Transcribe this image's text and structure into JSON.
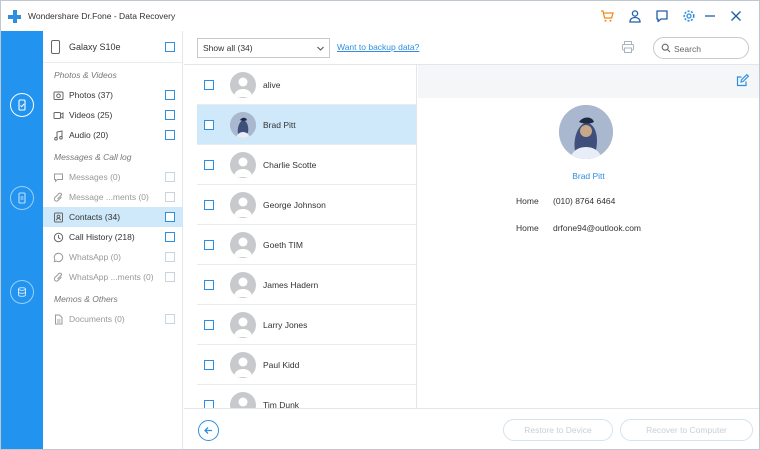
{
  "window": {
    "title": "Wondershare Dr.Fone - Data Recovery",
    "icons": [
      "cart-icon",
      "user-icon",
      "feedback-icon",
      "settings-icon",
      "minimize-icon",
      "close-icon"
    ]
  },
  "colors": {
    "accent": "#2294f0",
    "selected_row": "#cfe9fa",
    "link": "#2e8fe0"
  },
  "device": {
    "name": "Galaxy S10e"
  },
  "categories": {
    "photos_videos": {
      "label": "Photos & Videos",
      "items": [
        {
          "label": "Photos (37)",
          "icon": "photo-icon"
        },
        {
          "label": "Videos (25)",
          "icon": "video-icon"
        },
        {
          "label": "Audio (20)",
          "icon": "audio-icon"
        }
      ]
    },
    "messages_calllog": {
      "label": "Messages & Call log",
      "items": [
        {
          "label": "Messages (0)",
          "icon": "message-icon"
        },
        {
          "label": "Message ...ments (0)",
          "icon": "attachment-icon"
        },
        {
          "label": "Contacts (34)",
          "icon": "contacts-icon"
        },
        {
          "label": "Call History (218)",
          "icon": "call-history-icon"
        },
        {
          "label": "WhatsApp (0)",
          "icon": "whatsapp-icon"
        },
        {
          "label": "WhatsApp ...ments (0)",
          "icon": "whatsapp-attachment-icon"
        }
      ]
    },
    "memos_others": {
      "label": "Memos & Others",
      "items": [
        {
          "label": "Documents (0)",
          "icon": "document-icon"
        }
      ]
    }
  },
  "toolbar": {
    "filter_value": "Show all (34)",
    "backup_link": "Want to backup data?",
    "search_placeholder": "Search"
  },
  "contacts": [
    {
      "name": "alive"
    },
    {
      "name": "Brad Pitt",
      "selected": true
    },
    {
      "name": "Charlie Scotte"
    },
    {
      "name": "George Johnson"
    },
    {
      "name": "Goeth TIM"
    },
    {
      "name": "James Hadern"
    },
    {
      "name": "Larry Jones"
    },
    {
      "name": "Paul Kidd"
    },
    {
      "name": "Tim Dunk"
    }
  ],
  "detail": {
    "name": "Brad Pitt",
    "fields": [
      {
        "label": "Home",
        "value": "(010) 8764 6464"
      },
      {
        "label": "Home",
        "value": "drfone94@outlook.com"
      }
    ]
  },
  "footer": {
    "restore_label": "Restore to Device",
    "recover_label": "Recover to Computer"
  }
}
